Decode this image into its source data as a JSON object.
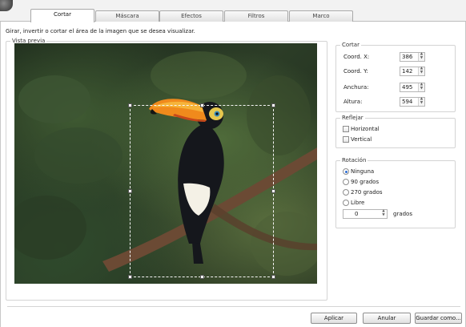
{
  "tabs": [
    {
      "label": "Cortar",
      "active": true
    },
    {
      "label": "Máscara",
      "active": false
    },
    {
      "label": "Efectos",
      "active": false
    },
    {
      "label": "Filtros",
      "active": false
    },
    {
      "label": "Marco",
      "active": false
    }
  ],
  "description": "Girar, invertir o cortar el área de la imagen que se desea visualizar.",
  "preview": {
    "title": "Vista previa"
  },
  "cortar": {
    "title": "Cortar",
    "fields": [
      {
        "label": "Coord. X:",
        "value": "386"
      },
      {
        "label": "Coord. Y:",
        "value": "142"
      },
      {
        "label": "Anchura:",
        "value": "495"
      },
      {
        "label": "Altura:",
        "value": "594"
      }
    ]
  },
  "reflejar": {
    "title": "Reflejar",
    "options": [
      {
        "label": "Horizontal",
        "checked": false
      },
      {
        "label": "Vertical",
        "checked": false
      }
    ]
  },
  "rotacion": {
    "title": "Rotación",
    "options": [
      {
        "label": "Ninguna",
        "selected": true
      },
      {
        "label": "90 grados",
        "selected": false
      },
      {
        "label": "270 grados",
        "selected": false
      },
      {
        "label": "Libre",
        "selected": false
      }
    ],
    "free_value": "0",
    "free_unit": "grados"
  },
  "buttons": {
    "apply": "Aplicar",
    "cancel": "Anular",
    "save_as": "Guardar como..."
  },
  "icons": {
    "app": "app-logo-icon",
    "spinner": "up-down-arrows-icon"
  }
}
